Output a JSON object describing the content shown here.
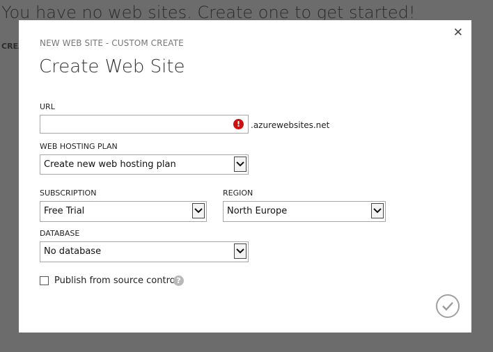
{
  "background": {
    "title": "You have no web sites. Create one to get started!",
    "link_text": "CREA"
  },
  "dialog": {
    "eyebrow": "NEW WEB SITE - CUSTOM CREATE",
    "title": "Create Web Site",
    "close_icon": "close-icon",
    "url": {
      "label": "URL",
      "value": "",
      "suffix": ".azurewebsites.net",
      "error_icon": "error-icon",
      "error_color": "#cc1111"
    },
    "hosting_plan": {
      "label": "WEB HOSTING PLAN",
      "selected": "Create new web hosting plan"
    },
    "subscription": {
      "label": "SUBSCRIPTION",
      "selected": "Free Trial"
    },
    "region": {
      "label": "REGION",
      "selected": "North Europe"
    },
    "database": {
      "label": "DATABASE",
      "selected": "No database"
    },
    "publish": {
      "label": "Publish from source control",
      "checked": false,
      "help_icon": "help-icon"
    },
    "confirm_icon": "checkmark-icon"
  }
}
